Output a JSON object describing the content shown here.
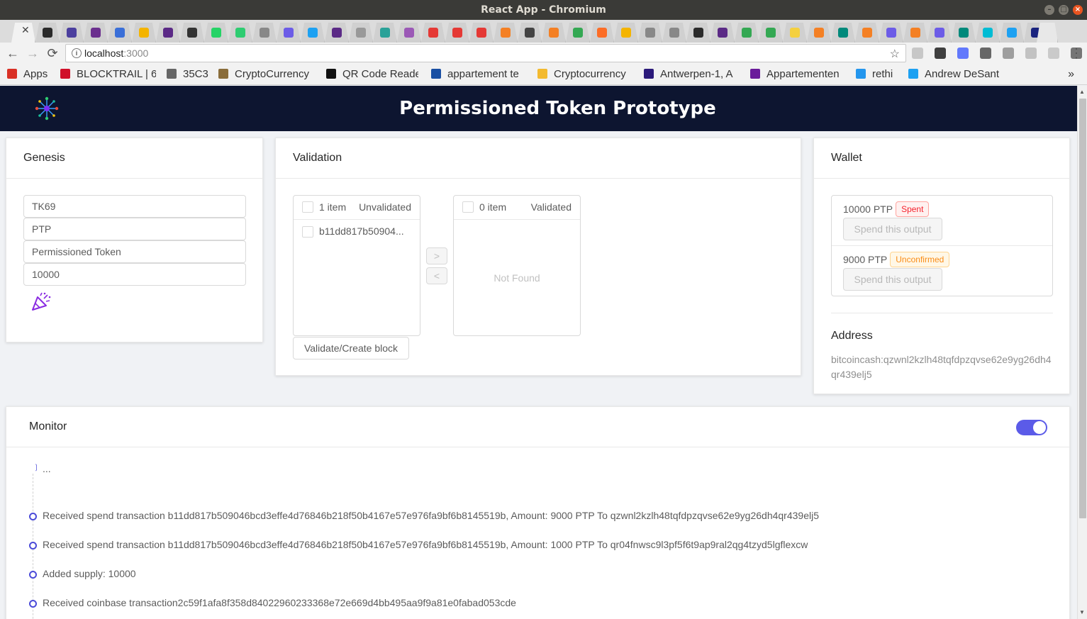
{
  "window": {
    "title": "React App - Chromium"
  },
  "browser": {
    "url_host": "localhost",
    "url_port": ":3000",
    "bookmarks": [
      {
        "label": "Apps",
        "color": "#d93025"
      },
      {
        "label": "BLOCKTRAIL | 6",
        "color": "#d0102a"
      },
      {
        "label": "35C3",
        "color": "#666666"
      },
      {
        "label": "CryptoCurrency",
        "color": "#8a6d3b"
      },
      {
        "label": "QR Code Reader",
        "color": "#111111"
      },
      {
        "label": "appartement te",
        "color": "#1a4fa3"
      },
      {
        "label": "Cryptocurrency",
        "color": "#f3ba2f"
      },
      {
        "label": "Antwerpen-1, A",
        "color": "#2b1a7a"
      },
      {
        "label": "Appartementen",
        "color": "#6a1b9a"
      },
      {
        "label": "rethi",
        "color": "#2496ed"
      },
      {
        "label": "Andrew DeSant",
        "color": "#1da1f2"
      }
    ],
    "bookmarks_more": "»"
  },
  "app": {
    "title": "Permissioned Token Prototype",
    "genesis": {
      "title": "Genesis",
      "fields": [
        "TK69",
        "PTP",
        "Permissioned Token",
        "10000"
      ],
      "create_icon": "party-popper-icon"
    },
    "validation": {
      "title": "Validation",
      "left": {
        "count": "1 item",
        "title": "Unvalidated",
        "items": [
          "b11dd817b50904..."
        ]
      },
      "right": {
        "count": "0 item",
        "title": "Validated",
        "empty": "Not Found"
      },
      "move_right": ">",
      "move_left": "<",
      "validate_button": "Validate/Create block"
    },
    "wallet": {
      "title": "Wallet",
      "outputs": [
        {
          "amount": "10000 PTP",
          "status": "Spent",
          "button": "Spend this output"
        },
        {
          "amount": "9000 PTP",
          "status": "Unconfirmed",
          "button": "Spend this output"
        }
      ],
      "address_label": "Address",
      "address_line1": "bitcoincash:qzwnl2kzlh48tqfdpzqvse62e9yg26dh4",
      "address_line2": "qr439elj5"
    },
    "monitor": {
      "title": "Monitor",
      "pending": "...",
      "events": [
        "Received spend transaction b11dd817b509046bcd3effe4d76846b218f50b4167e57e976fa9bf6b8145519b, Amount: 9000 PTP To qzwnl2kzlh48tqfdpzqvse62e9yg26dh4qr439elj5",
        "Received spend transaction b11dd817b509046bcd3effe4d76846b218f50b4167e57e976fa9bf6b8145519b, Amount: 1000 PTP To qr04fnwsc9l3pf5f6t9ap9ral2qg4tzyd5lgflexcw",
        "Added supply: 10000",
        "Received coinbase transaction2c59f1afa8f358d84022960233368e72e669d4bb495aa9f9a81e0fabad053cde"
      ]
    }
  }
}
